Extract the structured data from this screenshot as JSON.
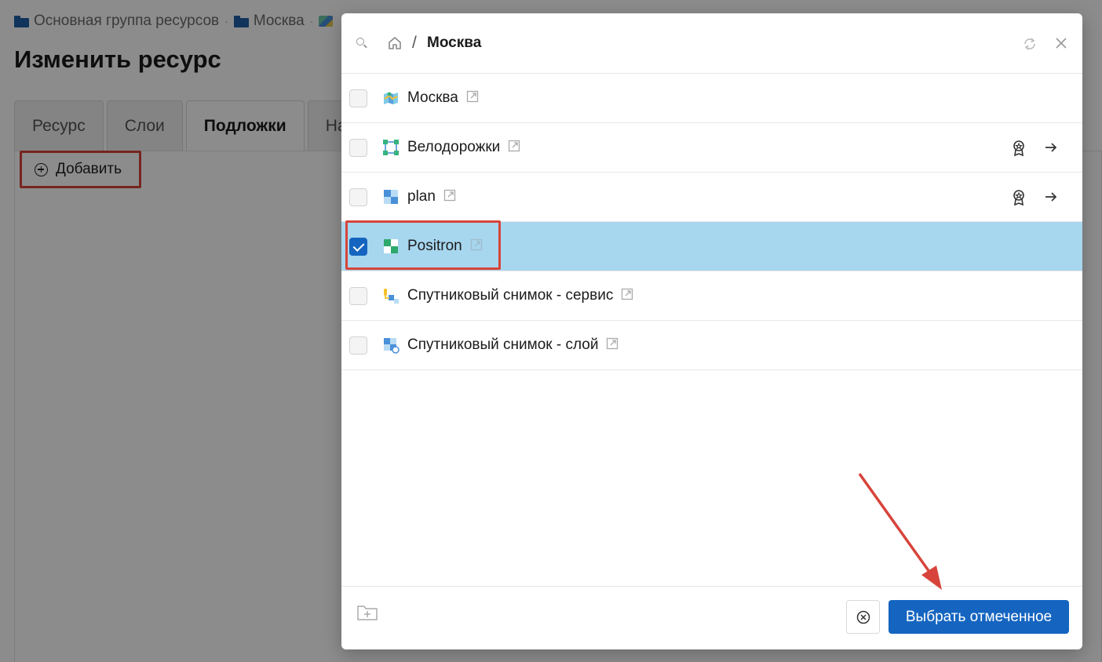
{
  "breadcrumb": {
    "items": [
      "Основная группа ресурсов",
      "Москва"
    ],
    "separator": "·"
  },
  "page": {
    "title": "Изменить ресурс",
    "tabs": [
      {
        "label": "Ресурс",
        "active": false
      },
      {
        "label": "Слои",
        "active": false
      },
      {
        "label": "Подложки",
        "active": true
      },
      {
        "label": "На",
        "active": false
      }
    ],
    "add_label": "Добавить"
  },
  "modal": {
    "path_separator": "/",
    "title": "Москва",
    "items": [
      {
        "label": "Москва",
        "icon": "webmap-icon",
        "checked": false,
        "has_actions": false
      },
      {
        "label": "Велодорожки",
        "icon": "vector-layer-icon",
        "checked": false,
        "has_actions": true
      },
      {
        "label": "plan",
        "icon": "raster-layer-icon",
        "checked": false,
        "has_actions": true
      },
      {
        "label": "Positron",
        "icon": "basemap-layer-icon",
        "checked": true,
        "has_actions": false
      },
      {
        "label": "Спутниковый снимок - сервис",
        "icon": "tms-connection-icon",
        "checked": false,
        "has_actions": false
      },
      {
        "label": "Спутниковый снимок - слой",
        "icon": "tms-layer-icon",
        "checked": false,
        "has_actions": false
      }
    ],
    "footer": {
      "select_label": "Выбрать отмеченное"
    }
  },
  "colors": {
    "accent": "#1565c0",
    "selected_row": "#a7d6ef",
    "highlight": "#d7443b"
  }
}
